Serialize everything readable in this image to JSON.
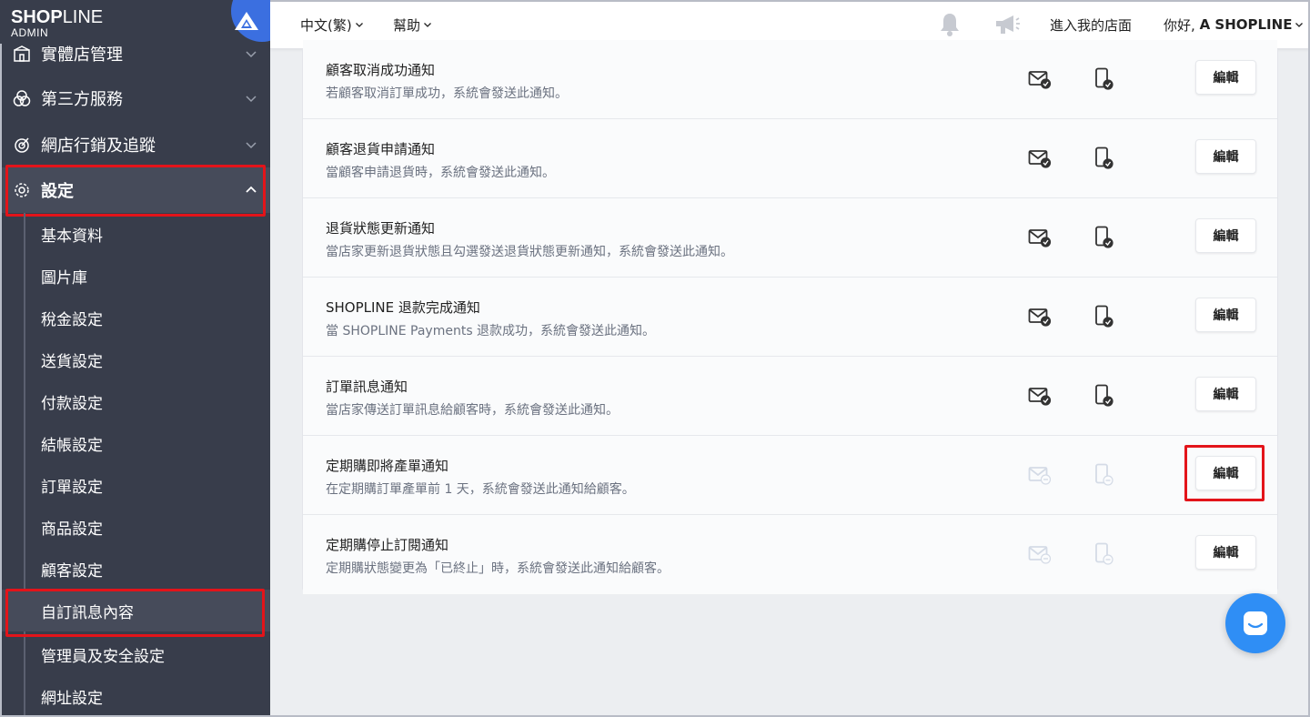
{
  "logo": {
    "brand_a": "SHOP",
    "brand_b": "LINE",
    "sub": "ADMIN"
  },
  "sidebar": {
    "items": [
      {
        "label": "實體店管理",
        "icon": "store-icon"
      },
      {
        "label": "第三方服務",
        "icon": "circles-icon"
      },
      {
        "label": "網店行銷及追蹤",
        "icon": "target-icon"
      },
      {
        "label": "設定",
        "icon": "gear-icon"
      }
    ],
    "sub_items": [
      "基本資料",
      "圖片庫",
      "稅金設定",
      "送貨設定",
      "付款設定",
      "結帳設定",
      "訂單設定",
      "商品設定",
      "顧客設定",
      "自訂訊息內容",
      "管理員及安全設定",
      "網址設定"
    ]
  },
  "header": {
    "language": "中文(繁)",
    "help": "幫助",
    "enter_store": "進入我的店面",
    "greeting": "你好, ",
    "user": "A SHOPLINE"
  },
  "notifications": [
    {
      "title": "顧客取消成功通知",
      "desc": "若顧客取消訂單成功，系統會發送此通知。",
      "enabled": true,
      "edit": "編輯"
    },
    {
      "title": "顧客退貨申請通知",
      "desc": "當顧客申請退貨時，系統會發送此通知。",
      "enabled": true,
      "edit": "編輯"
    },
    {
      "title": "退貨狀態更新通知",
      "desc": "當店家更新退貨狀態且勾選發送退貨狀態更新通知，系統會發送此通知。",
      "enabled": true,
      "edit": "編輯"
    },
    {
      "title": "SHOPLINE 退款完成通知",
      "desc": "當 SHOPLINE Payments 退款成功，系統會發送此通知。",
      "enabled": true,
      "edit": "編輯"
    },
    {
      "title": "訂單訊息通知",
      "desc": "當店家傳送訂單訊息給顧客時，系統會發送此通知。",
      "enabled": true,
      "edit": "編輯"
    },
    {
      "title": "定期購即將產單通知",
      "desc": "在定期購訂單產單前 1 天，系統會發送此通知給顧客。",
      "enabled": false,
      "edit": "編輯"
    },
    {
      "title": "定期購停止訂閱通知",
      "desc": "定期購狀態變更為「已終止」時，系統會發送此通知給顧客。",
      "enabled": false,
      "edit": "編輯"
    }
  ],
  "colors": {
    "sidebar_bg": "#383d4b",
    "accent": "#2f8ef5",
    "highlight": "#e3141a"
  }
}
